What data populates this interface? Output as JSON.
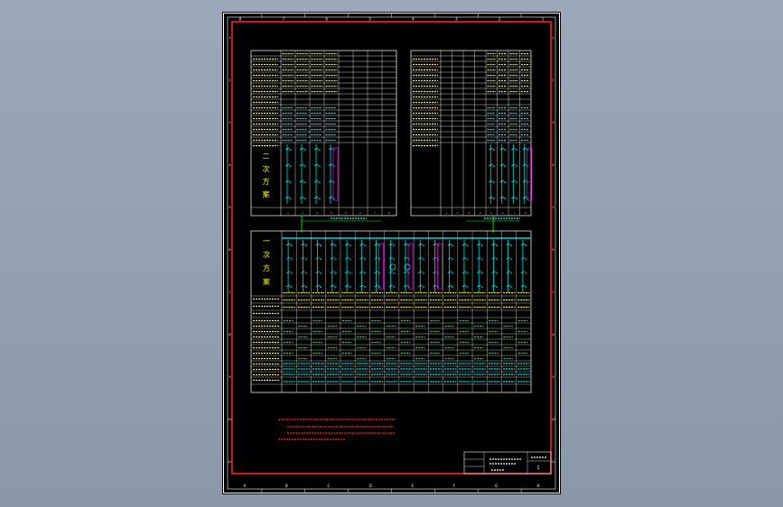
{
  "viewer": {
    "background_top": "#9aa8b9",
    "background_bottom": "#8a98aa"
  },
  "colors": {
    "frame": "#ffffff",
    "border": "#ff2020",
    "grid": "#ffffff",
    "header_text": "#ffff00",
    "device": "#00ffff",
    "device_alt": "#ff00ff",
    "bus": "#00ff00",
    "note": "#ff2020"
  },
  "zone_marks": {
    "top": [
      "8",
      "7",
      "6",
      "5",
      "4",
      "3",
      "2",
      "1"
    ],
    "bottom": [
      "A",
      "B",
      "C",
      "D",
      "E",
      "F",
      "G",
      "H"
    ],
    "left": [
      "1",
      "2",
      "3",
      "4",
      "5",
      "6",
      "7",
      "8",
      "9",
      "10",
      "11"
    ],
    "right": [
      "1",
      "2",
      "3",
      "4",
      "5",
      "6",
      "7",
      "8",
      "9",
      "10",
      "11"
    ]
  },
  "upper_left_table": {
    "section_label": [
      "二",
      "次",
      "方",
      "案"
    ],
    "panel_count": 4,
    "column_count": 8
  },
  "upper_right_table": {
    "section_label": [],
    "panel_count": 4,
    "column_count": 8
  },
  "main_table": {
    "section_label": [
      "一",
      "次",
      "方",
      "案"
    ],
    "panel_count": 17
  },
  "title_block": {
    "sheet_number": "1"
  }
}
